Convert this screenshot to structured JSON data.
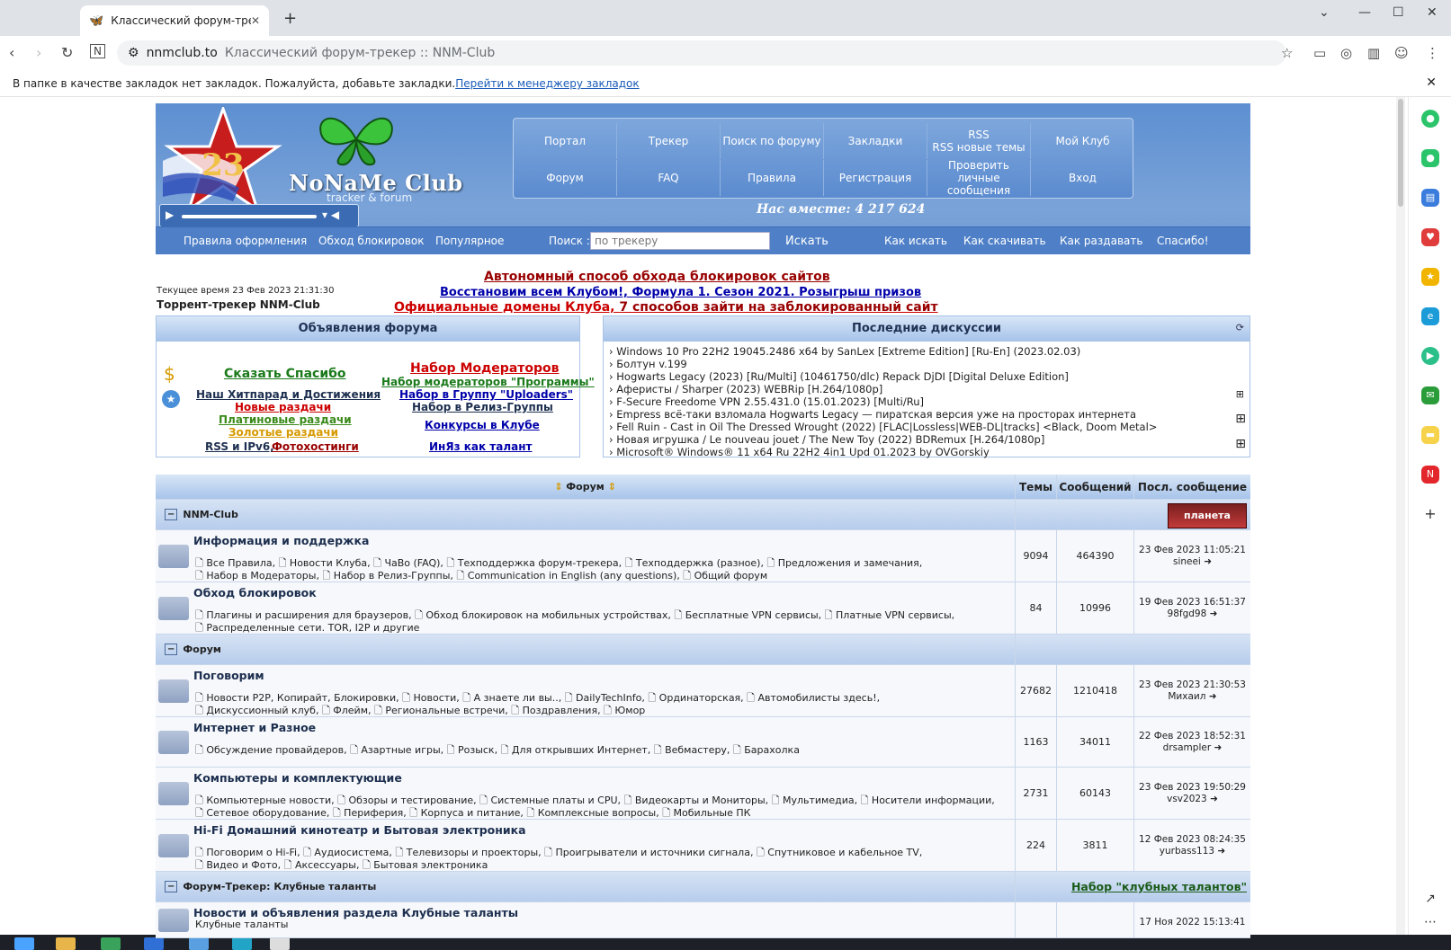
{
  "browser": {
    "tab_title": "Классический форум-трекер ::",
    "domain": "nnmclub.to",
    "page_title": "Классический форум-трекер :: NNM-Club",
    "bookmark_notice": "В папке в качестве закладок нет закладок. Пожалуйста, добавьте закладки.",
    "bookmark_link": "Перейти к менеджеру закладок"
  },
  "logo": {
    "badge": "23",
    "name": "NoNaMe Club",
    "sub": "tracker & forum"
  },
  "topmenu": [
    {
      "label": "Портал"
    },
    {
      "label": "Трекер"
    },
    {
      "label": "Поиск по форуму"
    },
    {
      "label": "Закладки"
    },
    {
      "label": "RSS\nRSS новые темы"
    },
    {
      "label": "Мой Клуб"
    },
    {
      "label": "Форум"
    },
    {
      "label": "FAQ"
    },
    {
      "label": "Правила"
    },
    {
      "label": "Регистрация"
    },
    {
      "label": "Проверить личные сообщения"
    },
    {
      "label": "Вход"
    }
  ],
  "together": "Нас вместе: 4 217 624",
  "subbar": {
    "links": [
      "Правила оформления",
      "Обход блокировок",
      "Популярное"
    ],
    "search_label": "Поиск :",
    "search_placeholder": "по трекеру",
    "search_button": "Искать",
    "right_links": [
      "Как искать",
      "Как скачивать",
      "Как раздавать",
      "Спасибо!"
    ]
  },
  "announce": {
    "line1": "Автономный способ обхода блокировок сайтов",
    "line2a": "Восстановим всем Клубом!,",
    "line2b": "Формула 1. Сезон 2021. Розыгрыш призов",
    "line3a": "Официальные домены Клуба,",
    "line3b": "7 способов зайти на заблокированный сайт",
    "current_time": "Текущее время 23 Фев 2023 21:31:30",
    "tracker_name": "Торрент-трекер NNM-Club"
  },
  "ads_box": {
    "title": "Объявления форума",
    "left": [
      {
        "t": "Сказать Спасибо",
        "c": "#1a7a1a"
      },
      {
        "t": "Наш Хитпарад и Достижения",
        "c": "#1d2f4f"
      },
      {
        "t": "Новые раздачи",
        "c": "#c00"
      },
      {
        "t": "Платиновые раздачи",
        "c": "#3a8a1a"
      },
      {
        "t": "Золотые раздачи",
        "c": "#d69a00"
      },
      {
        "t": "RSS и IPv6,",
        "c": "#1d2f4f"
      },
      {
        "t": "Фотохостинги",
        "c": "#900"
      }
    ],
    "right": [
      {
        "t": "Набор Модераторов",
        "c": "#c00"
      },
      {
        "t": "Набор модераторов \"Программы\"",
        "c": "#1a7a1a"
      },
      {
        "t": "Набор в Группу \"Uploaders\"",
        "c": "#00a"
      },
      {
        "t": "Набор в Релиз-Группы",
        "c": "#1d2f4f"
      },
      {
        "t": "Конкурсы в Клубе",
        "c": "#00a"
      },
      {
        "t": "ИнЯз как талант",
        "c": "#00a"
      }
    ]
  },
  "discussions": {
    "title": "Последние дискуссии",
    "items": [
      "› Windows 10 Pro 22H2 19045.2486 x64 by SanLex [Extreme Edition] [Ru-En] (2023.02.03)",
      "› Болтун v.199",
      "› Hogwarts Legacy (2023) [Ru/Multi] (10461750/dlc) Repack DjDI [Digital Deluxe Edition]",
      "› Аферисты / Sharper (2023) WEBRip [H.264/1080p]",
      "› F-Secure Freedome VPN 2.55.431.0 (15.01.2023) [Multi/Ru]",
      "› Empress всё-таки взломала Hogwarts Legacy — пиратская версия уже на просторах интернета",
      "› Fell Ruin - Cast in Oil The Dressed Wrought (2022) [FLAC|Lossless|WEB-DL|tracks] <Black, Doom Metal>",
      "› Новая игрушка / Le nouveau jouet / The New Toy (2022) BDRemux [H.264/1080p]",
      "› Microsoft® Windows® 11 x64 Ru 22H2 4in1 Upd 01.2023 by OVGorskiy"
    ]
  },
  "forum_table": {
    "col_forum": "Форум",
    "col_topics": "Темы",
    "col_posts": "Сообщений",
    "col_last": "Посл. сообщение",
    "cat1": "NNM-Club",
    "cat1_badge": "планета",
    "cat2": "Форум",
    "cat3": "Форум-Трекер: Клубные таланты",
    "cat3_link": "Набор \"клубных талантов\"",
    "forums": [
      {
        "name": "Информация и поддержка",
        "subs1": "Все Правила, 🗋 Новости Клуба, 🗋 ЧаВо (FAQ), 🗋 Техподдержка форум-трекера, 🗋 Техподдержка (разное), 🗋 Предложения и замечания,",
        "subs2": "Набор в Модераторы, 🗋 Набор в Релиз-Группы, 🗋 Communication in English (any questions), 🗋 Общий форум",
        "topics": "9094",
        "posts": "464390",
        "date": "23 Фев 2023 11:05:21",
        "user": "sineei"
      },
      {
        "name": "Обход блокировок",
        "subs1": "Плагины и расширения для браузеров, 🗋 Обход блокировок на мобильных устройствах, 🗋 Бесплатные VPN сервисы, 🗋 Платные VPN сервисы,",
        "subs2": "Распределенные сети. TOR, I2P и другие",
        "topics": "84",
        "posts": "10996",
        "date": "19 Фев 2023 16:51:37",
        "user": "98fgd98"
      },
      {
        "name": "Поговорим",
        "subs1": "Новости P2P, Копирайт, Блокировки, 🗋 Новости, 🗋 А знаете ли вы.., 🗋 DailyTechInfo, 🗋 Ординаторская, 🗋 Автомобилисты здесь!,",
        "subs2": "Дискуссионный клуб, 🗋 Флейм, 🗋 Региональные встречи, 🗋 Поздравления, 🗋 Юмор",
        "topics": "27682",
        "posts": "1210418",
        "date": "23 Фев 2023 21:30:53",
        "user": "Михаил"
      },
      {
        "name": "Интернет и Разное",
        "subs1": "Обсуждение провайдеров, 🗋 Азартные игры, 🗋 Розыск, 🗋 Для открывших Интернет, 🗋 Вебмастеру, 🗋 Барахолка",
        "subs2": "",
        "topics": "1163",
        "posts": "34011",
        "date": "22 Фев 2023 18:52:31",
        "user": "drsampler"
      },
      {
        "name": "Компьютеры и комплектующие",
        "subs1": "Компьютерные новости, 🗋 Обзоры и тестирование, 🗋 Системные платы и CPU, 🗋 Видеокарты и Мониторы, 🗋 Мультимедиа, 🗋 Носители информации,",
        "subs2": "Сетевое оборудование, 🗋 Периферия, 🗋 Корпуса и питание, 🗋 Комплексные вопросы, 🗋 Мобильные ПК",
        "topics": "2731",
        "posts": "60143",
        "date": "23 Фев 2023 19:50:29",
        "user": "vsv2023"
      },
      {
        "name": "Hi-Fi Домашний кинотеатр и Бытовая электроника",
        "subs1": "Поговорим о Hi-Fi, 🗋 Аудиосистема, 🗋 Телевизоры и проекторы, 🗋 Проигрыватели и источники сигнала, 🗋 Спутниковое и кабельное TV,",
        "subs2": "Видео и Фото, 🗋 Аксессуары, 🗋 Бытовая электроника",
        "topics": "224",
        "posts": "3811",
        "date": "12 Фев 2023 08:24:35",
        "user": "yurbass113"
      },
      {
        "name": "Новости и объявления раздела Клубные таланты",
        "subs1": "Клубные таланты",
        "subs2": "",
        "topics": "",
        "posts": "",
        "date": "17 Ноя 2022 15:13:41",
        "user": ""
      }
    ]
  },
  "colors": {
    "header": "#6b97d2",
    "accent": "#4f80c7"
  }
}
